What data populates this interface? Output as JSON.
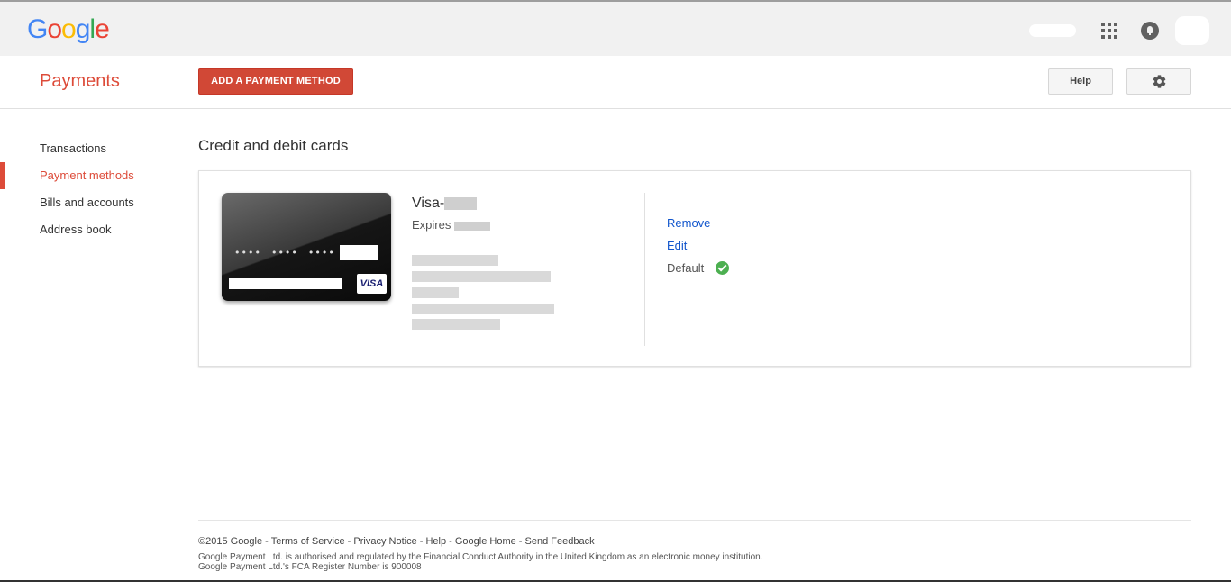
{
  "logo": {
    "letters": [
      "G",
      "o",
      "o",
      "g",
      "l",
      "e"
    ],
    "colors": [
      "#4285f4",
      "#ea4335",
      "#fbbc05",
      "#4285f4",
      "#34a853",
      "#ea4335"
    ]
  },
  "header": {
    "title": "Payments",
    "add_button": "ADD A PAYMENT METHOD",
    "help_button": "Help"
  },
  "sidebar": {
    "items": [
      {
        "label": "Transactions"
      },
      {
        "label": "Payment methods"
      },
      {
        "label": "Bills and accounts"
      },
      {
        "label": "Address book"
      }
    ]
  },
  "main": {
    "section_title": "Credit and debit cards",
    "card": {
      "name_prefix": "Visa-",
      "expires_label": "Expires",
      "brand": "VISA",
      "number_mask": [
        "••••",
        "••••",
        "••••"
      ],
      "actions": {
        "remove": "Remove",
        "edit": "Edit",
        "default": "Default"
      }
    }
  },
  "footer": {
    "copyright": "©2015 Google",
    "links": [
      "Terms of Service",
      "Privacy Notice",
      "Help",
      "Google Home",
      "Send Feedback"
    ],
    "separator": " - ",
    "line1": "Google Payment Ltd. is authorised and regulated by the Financial Conduct Authority in the United Kingdom as an electronic money institution.",
    "line2": "Google Payment Ltd.'s FCA Register Number is 900008"
  },
  "colors": {
    "accent": "#dd4b39",
    "link": "#1155cc",
    "default_check": "#4caf50"
  }
}
